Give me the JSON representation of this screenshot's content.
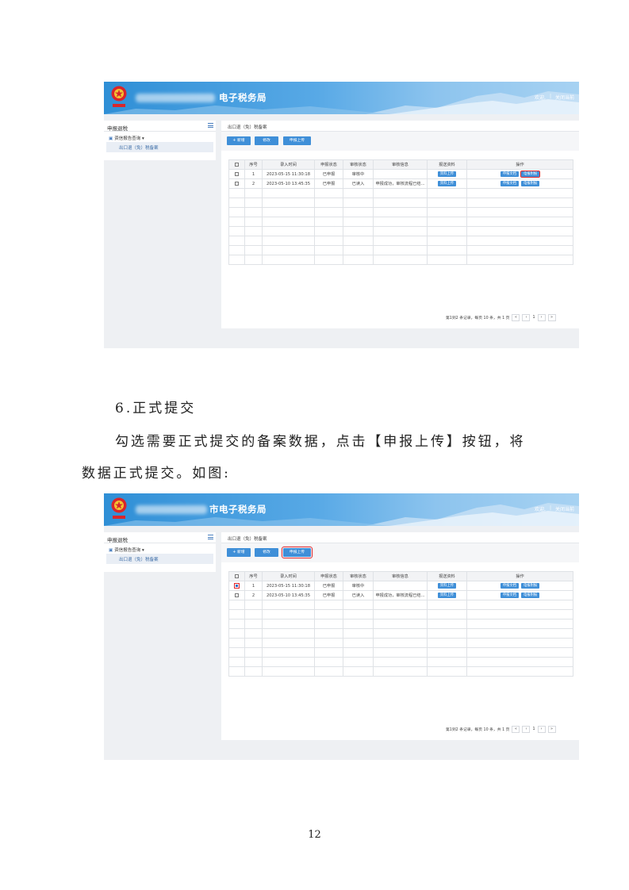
{
  "screens": [
    {
      "site_title": "电子税务局",
      "header_links": [
        "欢迎,",
        "|",
        "关闭当前"
      ],
      "sidebar": {
        "title": "申报退税",
        "group": "资信报告查询",
        "item": "出口退（免）税备案"
      },
      "breadcrumb": "出口退（免）税备案",
      "buttons": {
        "add": "+ 新增",
        "edit": "修改",
        "upload": "申报上传"
      },
      "table": {
        "headers": [
          "",
          "序号",
          "录入时间",
          "申报状态",
          "审核状态",
          "审核信息",
          "报送资料",
          "操作"
        ],
        "rows": [
          {
            "no": "1",
            "time": "2023-05-15 11:30:18",
            "declare": "已申报",
            "audit": "审核中",
            "info": "",
            "material": "资料上传",
            "op1": "申报文档",
            "op2": "电报附报"
          },
          {
            "no": "2",
            "time": "2023-05-10 13:45:35",
            "declare": "已申报",
            "audit": "已读入",
            "info": "申报成功，审核流程已结...",
            "material": "资料上传",
            "op1": "申报文档",
            "op2": "电报附报"
          }
        ]
      },
      "pager": {
        "summary": "第1到2 条记录，每页 10 条，共 1 页",
        "first": "«",
        "prev": "‹",
        "page": "1",
        "next": "›",
        "last": "»"
      }
    },
    {
      "site_title": "市电子税务局",
      "header_links": [
        "欢迎,",
        "|",
        "关闭当前"
      ],
      "sidebar": {
        "title": "申报退税",
        "group": "资信报告查询",
        "item": "出口退（免）税备案"
      },
      "breadcrumb": "出口退（免）税备案",
      "buttons": {
        "add": "+ 新增",
        "edit": "修改",
        "upload": "申报上传"
      },
      "table": {
        "headers": [
          "",
          "序号",
          "录入时间",
          "申报状态",
          "审核状态",
          "审核信息",
          "报送资料",
          "操作"
        ],
        "rows": [
          {
            "no": "1",
            "time": "2023-05-15 11:30:18",
            "declare": "已申报",
            "audit": "审核中",
            "info": "",
            "material": "资料上传",
            "op1": "申报文档",
            "op2": "电报附报"
          },
          {
            "no": "2",
            "time": "2023-05-10 13:45:35",
            "declare": "已申报",
            "audit": "已读入",
            "info": "申报成功，审核流程已结...",
            "material": "资料上传",
            "op1": "申报文档",
            "op2": "电报附报"
          }
        ]
      },
      "pager": {
        "summary": "第1到2 条记录，每页 10 条，共 1 页",
        "first": "«",
        "prev": "‹",
        "page": "1",
        "next": "›",
        "last": "»"
      }
    }
  ],
  "text": {
    "heading": "6.正式提交",
    "para1": "勾选需要正式提交的备案数据，点击【申报上传】按钮，将",
    "para2": "数据正式提交。如图:",
    "page_number": "12"
  },
  "colors": {
    "header_blue": "#2f8fd6",
    "button_blue": "#3f8fd8",
    "highlight_red": "#e0262b"
  }
}
